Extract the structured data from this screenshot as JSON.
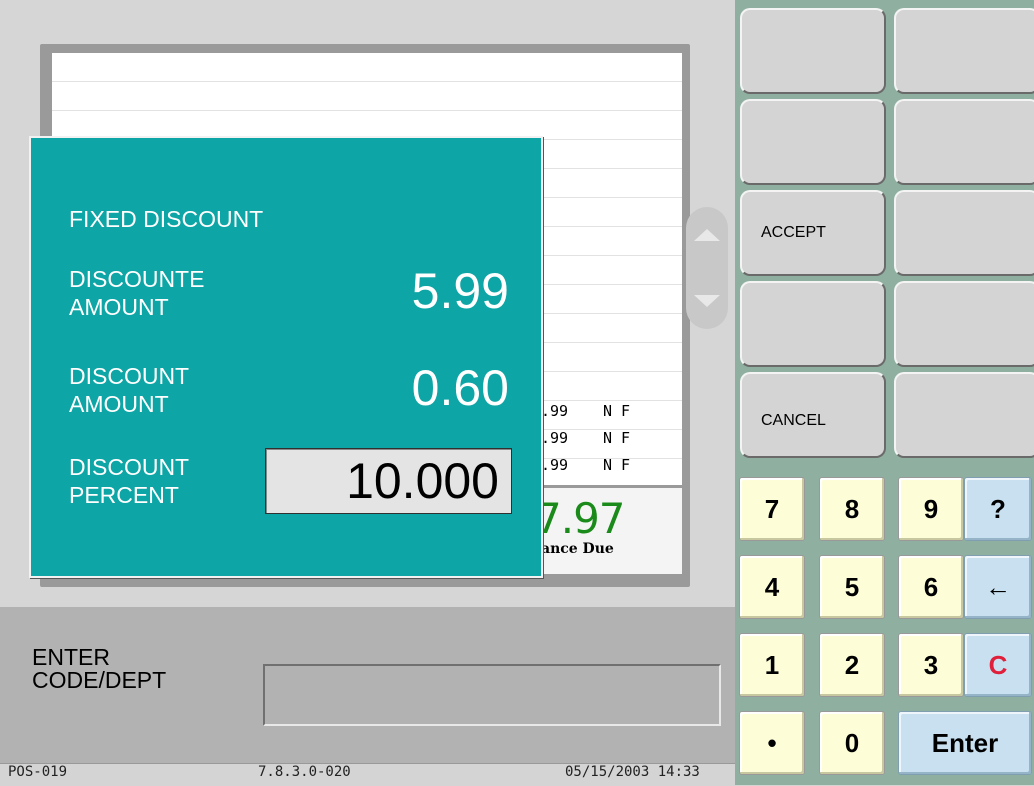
{
  "receipt": {
    "items": [
      {
        "price": ".99",
        "flags": "N F"
      },
      {
        "price": ".99",
        "flags": "N F"
      },
      {
        "price": ".99",
        "flags": "N F"
      }
    ],
    "total_value": "7.97",
    "total_label": "ance Due"
  },
  "dialog": {
    "title": "FIXED  DISCOUNT",
    "discounted_label_1": "DISCOUNTE",
    "discounted_label_2": "AMOUNT",
    "discounted_value": "5.99",
    "discount_amount_label_1": "DISCOUNT",
    "discount_amount_label_2": "AMOUNT",
    "discount_amount_value": "0.60",
    "discount_percent_label_1": "DISCOUNT",
    "discount_percent_label_2": "PERCENT",
    "discount_percent_value": "10.000"
  },
  "input": {
    "prompt_1": "ENTER",
    "prompt_2": "CODE/DEPT",
    "value": ""
  },
  "status": {
    "terminal": "POS-019",
    "version": "7.8.3.0-020",
    "datetime": "05/15/2003 14:33"
  },
  "function_keys": {
    "accept": "ACCEPT",
    "cancel": "CANCEL"
  },
  "keypad": {
    "k7": "7",
    "k8": "8",
    "k9": "9",
    "help": "?",
    "k4": "4",
    "k5": "5",
    "k6": "6",
    "backspace": "←",
    "k1": "1",
    "k2": "2",
    "k3": "3",
    "clear": "C",
    "dot": "•",
    "k0": "0",
    "enter": "Enter"
  },
  "colors": {
    "dialog_bg": "#0da5a5",
    "total_green": "#1a8a1a",
    "clear_red": "#e0203a",
    "keypad_bg": "#8fb0a0"
  }
}
